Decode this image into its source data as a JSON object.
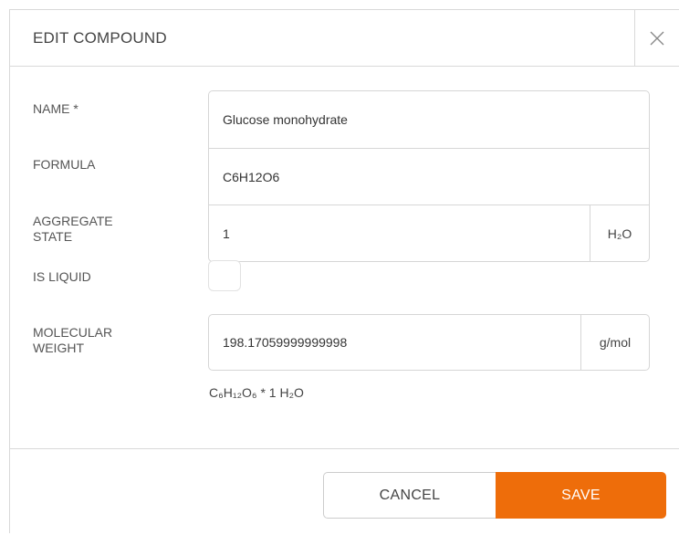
{
  "dialog": {
    "title": "EDIT COMPOUND",
    "close_icon": "close-icon"
  },
  "labels": {
    "name": "NAME *",
    "formula": "FORMULA",
    "aggregate_state_line1": "AGGREGATE",
    "aggregate_state_line2": "STATE",
    "is_liquid": "IS LIQUID",
    "molecular_weight_line1": "MOLECULAR",
    "molecular_weight_line2": "WEIGHT"
  },
  "fields": {
    "name": "Glucose monohydrate",
    "formula": "C6H12O6",
    "aggregate_state": "1",
    "aggregate_state_unit": "H₂O",
    "is_liquid": false,
    "molecular_weight": "198.17059999999998",
    "molecular_weight_unit": "g/mol"
  },
  "formula_note": "C₆H₁₂O₆ * 1 H₂O",
  "buttons": {
    "cancel": "CANCEL",
    "save": "SAVE"
  },
  "colors": {
    "save_button": "#ee6d0a",
    "border": "#d6d6d6"
  }
}
